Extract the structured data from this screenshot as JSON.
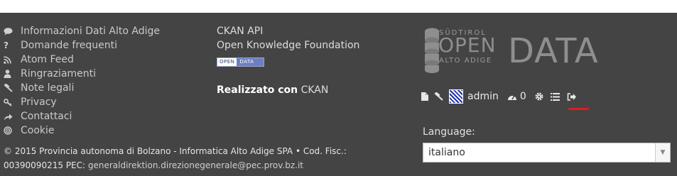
{
  "footer_links": [
    {
      "icon": "comment-icon",
      "label": "Informazioni Dati Alto Adige"
    },
    {
      "icon": "question-icon",
      "label": "Domande frequenti"
    },
    {
      "icon": "rss-icon",
      "label": "Atom Feed"
    },
    {
      "icon": "user-icon",
      "label": "Ringraziamenti"
    },
    {
      "icon": "gavel-icon",
      "label": "Note legali"
    },
    {
      "icon": "key-icon",
      "label": "Privacy"
    },
    {
      "icon": "share-icon",
      "label": "Contattaci"
    },
    {
      "icon": "bullseye-icon",
      "label": "Cookie"
    }
  ],
  "legal": {
    "line1": "© 2015 Provincia autonoma di Bolzano - Informatica Alto Adige SPA • Cod. Fisc.:",
    "line2_prefix": "00390090215 PEC:",
    "pec_email": "generaldirektion.direzionegenerale@pec.prov.bz.it"
  },
  "column2": {
    "api_link": "CKAN API",
    "okfn_link": "Open Knowledge Foundation",
    "badge_open": "OPEN",
    "badge_data": "DATA",
    "credit_prefix": "Realizzato con",
    "credit_link": "CKAN"
  },
  "logo": {
    "subtitle_top": "SÜDTIROL",
    "open_word": "OPEN",
    "subtitle_bottom": "ALTO ADIGE",
    "data_word": "DATA"
  },
  "account": {
    "username": "admin",
    "activity_count": "0"
  },
  "language": {
    "label": "Language:",
    "selected": "italiano"
  },
  "colors": {
    "footer_bg": "#444444",
    "active_underline": "#e31b23"
  }
}
